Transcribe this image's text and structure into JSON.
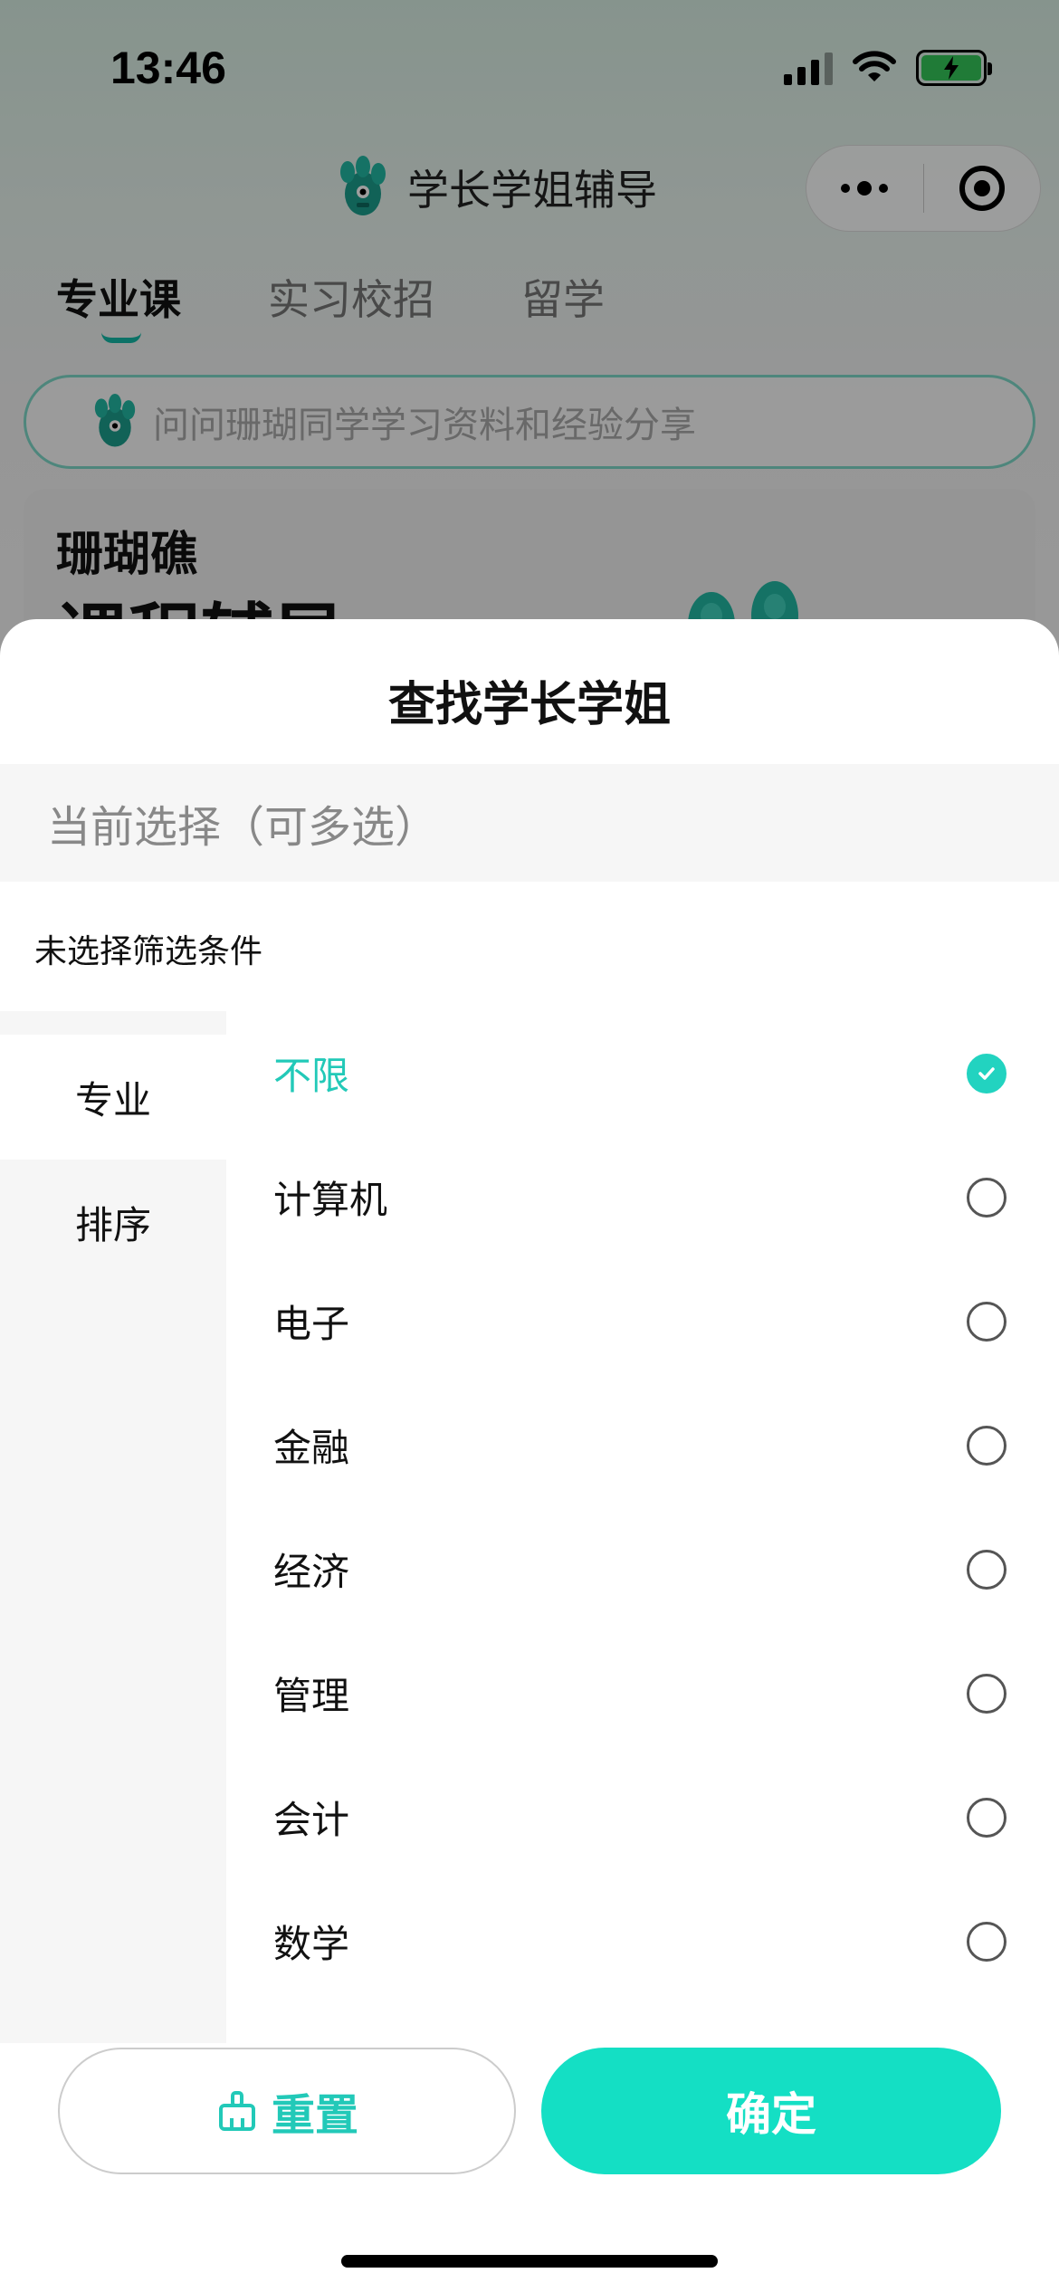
{
  "status_bar": {
    "time": "13:46"
  },
  "header": {
    "title": "学长学姐辅导"
  },
  "tabs": [
    {
      "label": "专业课",
      "active": true
    },
    {
      "label": "实习校招",
      "active": false
    },
    {
      "label": "留学",
      "active": false
    }
  ],
  "search": {
    "placeholder": "问问珊瑚同学学习资料和经验分享"
  },
  "banner": {
    "title": "珊瑚礁",
    "subtitle": "课程辅导"
  },
  "sheet": {
    "title": "查找学长学姐",
    "current_label": "当前选择（可多选）",
    "no_selection": "未选择筛选条件",
    "side_nav": [
      {
        "label": "专业",
        "active": true
      },
      {
        "label": "排序",
        "active": false
      }
    ],
    "options": [
      {
        "label": "不限",
        "checked": true
      },
      {
        "label": "计算机",
        "checked": false
      },
      {
        "label": "电子",
        "checked": false
      },
      {
        "label": "金融",
        "checked": false
      },
      {
        "label": "经济",
        "checked": false
      },
      {
        "label": "管理",
        "checked": false
      },
      {
        "label": "会计",
        "checked": false
      },
      {
        "label": "数学",
        "checked": false
      }
    ],
    "reset_label": "重置",
    "confirm_label": "确定"
  },
  "colors": {
    "accent": "#14dfc4",
    "accent_text": "#22c9b8"
  }
}
